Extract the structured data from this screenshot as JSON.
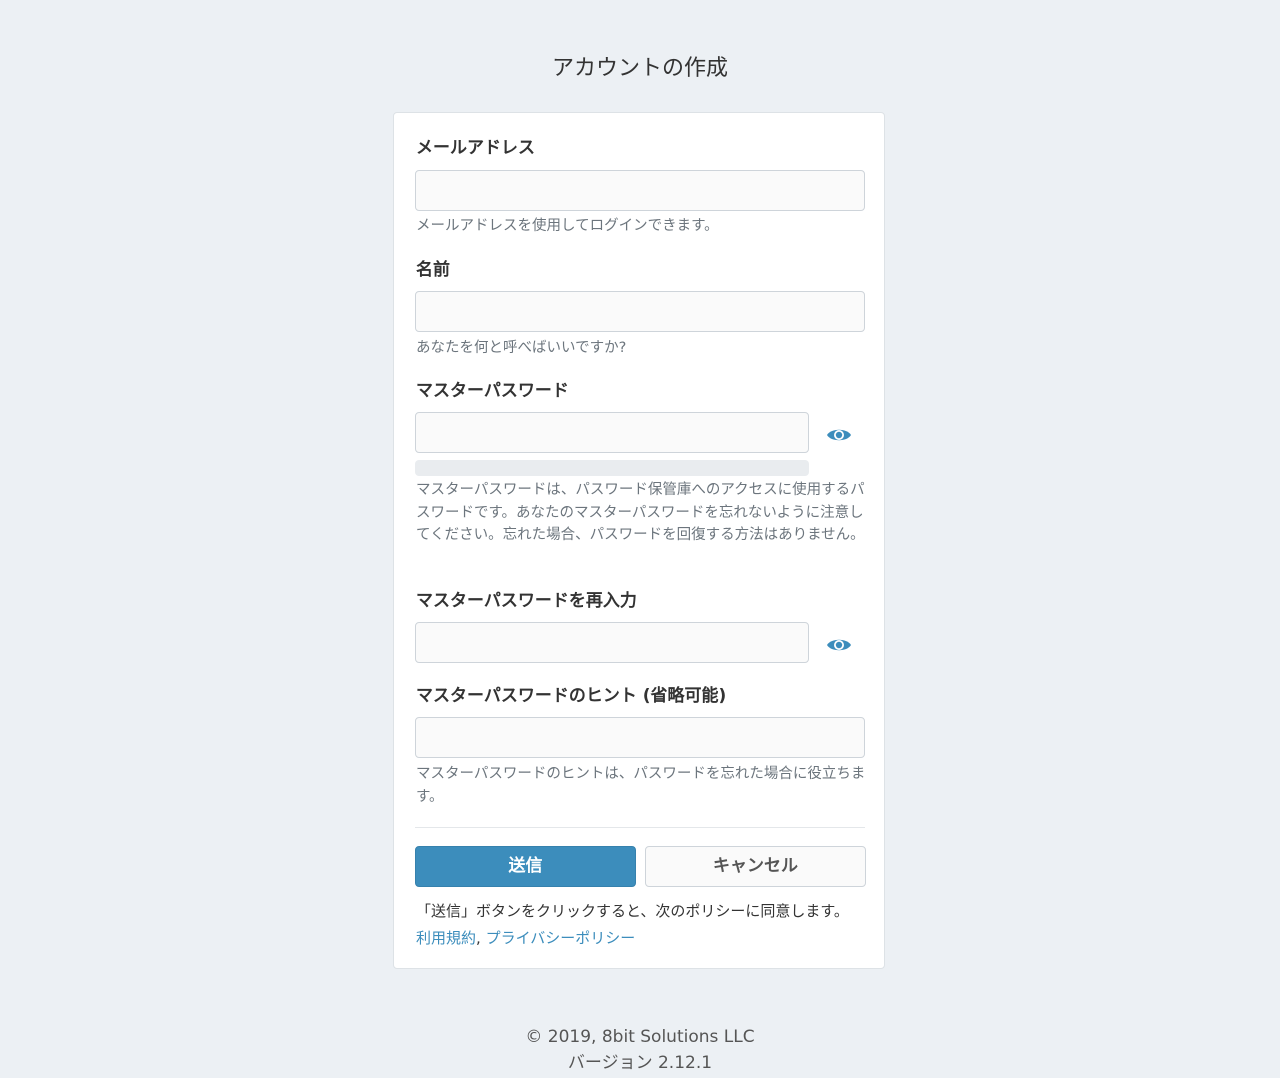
{
  "page": {
    "title": "アカウントの作成"
  },
  "form": {
    "email": {
      "label": "メールアドレス",
      "value": "",
      "help": "メールアドレスを使用してログインできます。"
    },
    "name": {
      "label": "名前",
      "value": "",
      "help": "あなたを何と呼べばいいですか?"
    },
    "master_password": {
      "label": "マスターパスワード",
      "value": "",
      "help": "マスターパスワードは、パスワード保管庫へのアクセスに使用するパスワードです。あなたのマスターパスワードを忘れないように注意してください。忘れた場合、パスワードを回復する方法はありません。",
      "strength": 0
    },
    "master_password_retype": {
      "label": "マスターパスワードを再入力",
      "value": ""
    },
    "hint": {
      "label": "マスターパスワードのヒント (省略可能)",
      "value": "",
      "help": "マスターパスワードのヒントは、パスワードを忘れた場合に役立ちます。"
    }
  },
  "buttons": {
    "submit": "送信",
    "cancel": "キャンセル"
  },
  "policy": {
    "text": "「送信」ボタンをクリックすると、次のポリシーに同意します。",
    "terms_link": "利用規約",
    "separator": ",",
    "privacy_link": "プライバシーポリシー"
  },
  "footer": {
    "copyright": "© 2019, 8bit Solutions LLC",
    "version": "バージョン 2.12.1"
  },
  "colors": {
    "accent": "#3c8dbc",
    "background": "#ecf0f4"
  },
  "icons": {
    "toggle_visibility": "eye-icon"
  }
}
